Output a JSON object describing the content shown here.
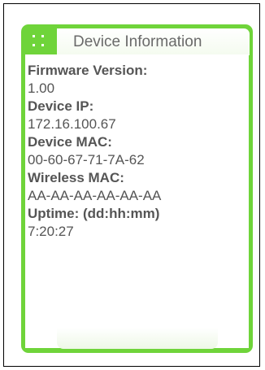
{
  "panel": {
    "title": "Device Information",
    "accent_color": "#6fd43a"
  },
  "fields": [
    {
      "label": "Firmware Version:",
      "value": "1.00"
    },
    {
      "label": "Device IP:",
      "value": "172.16.100.67"
    },
    {
      "label": "Device MAC:",
      "value": "00-60-67-71-7A-62"
    },
    {
      "label": "Wireless MAC:",
      "value": "AA-AA-AA-AA-AA-AA"
    },
    {
      "label": "Uptime: (dd:hh:mm)",
      "value": "7:20:27"
    }
  ]
}
